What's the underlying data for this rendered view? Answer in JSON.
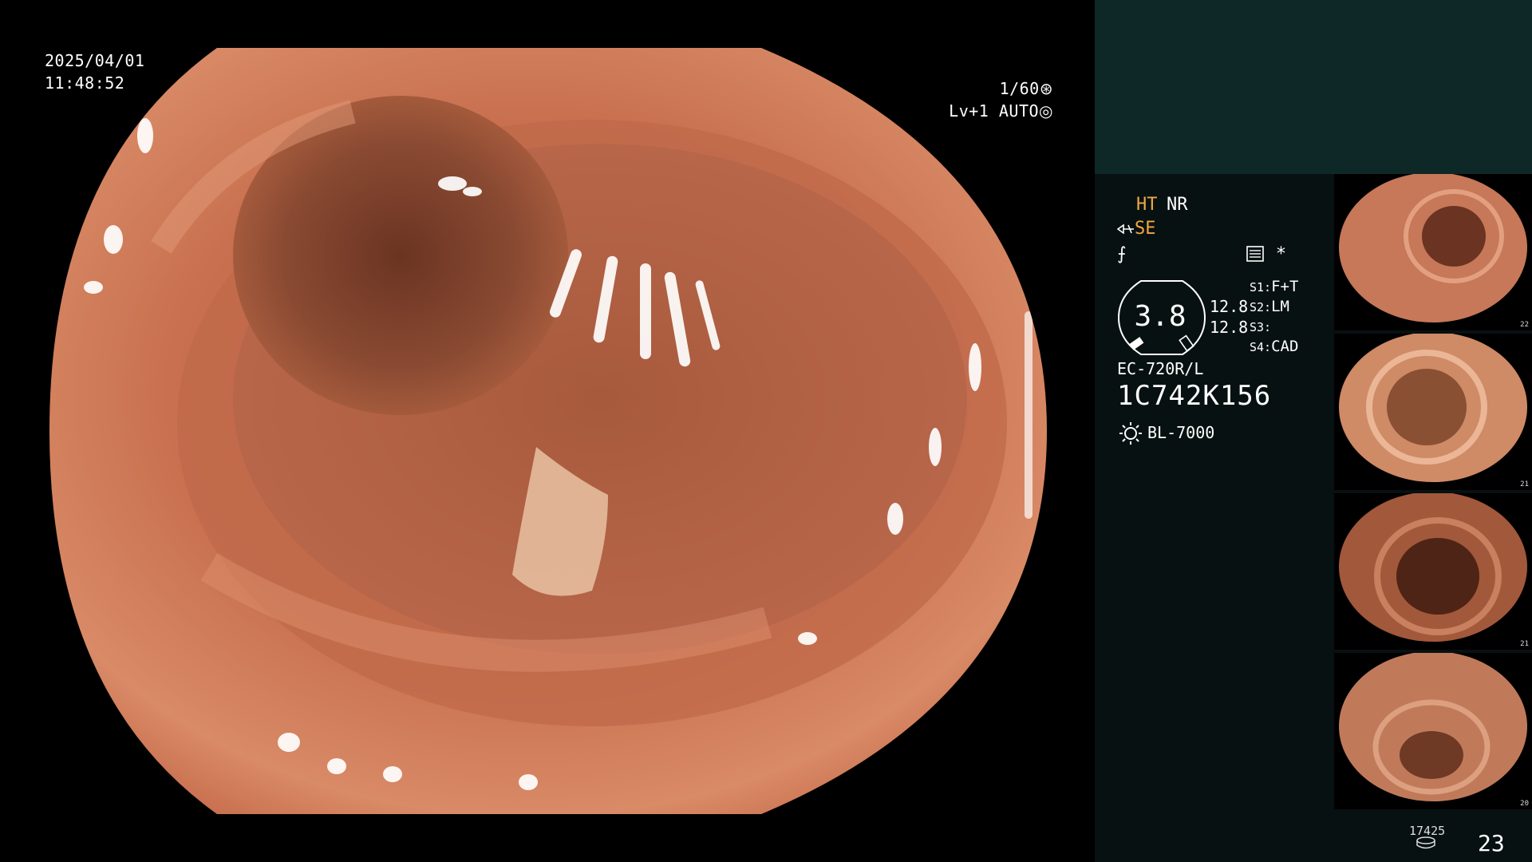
{
  "overlay": {
    "date": "2025/04/01",
    "time": "11:48:52",
    "shutter": "1/60",
    "shutter_icon": "aperture-icon",
    "level": "Lv+1",
    "exposure_mode": "AUTO",
    "exposure_icon": "iris-icon"
  },
  "processor": {
    "mode_ht": "HT",
    "mode_nr": "NR",
    "mode_se": "SE",
    "mode_se_icon": "enhance-icon",
    "mode_f": "⨍",
    "grid_icon": "settings-grid-icon",
    "star": "*",
    "gauge_value": "3.8",
    "s_value_1": "12.8",
    "s_value_2": "12.8",
    "s_settings": [
      {
        "key": "S1:",
        "value": "F+T"
      },
      {
        "key": "S2:",
        "value": "LM"
      },
      {
        "key": "S3:",
        "value": ""
      },
      {
        "key": "S4:",
        "value": "CAD"
      }
    ],
    "scope_model": "EC-720R/L",
    "serial": "1C742K156",
    "light_icon": "sun-icon",
    "light_source": "BL-7000"
  },
  "thumbnails": [
    {
      "index": "22"
    },
    {
      "index": "21"
    },
    {
      "index": "21"
    },
    {
      "index": "20"
    }
  ],
  "footer": {
    "count": "17425",
    "storage_icon": "disk-icon",
    "page": "23"
  },
  "colors": {
    "panel_top": "#0e2828",
    "panel_bg": "#081111",
    "accent_orange": "#f0a844",
    "tissue": "#c8684a"
  }
}
